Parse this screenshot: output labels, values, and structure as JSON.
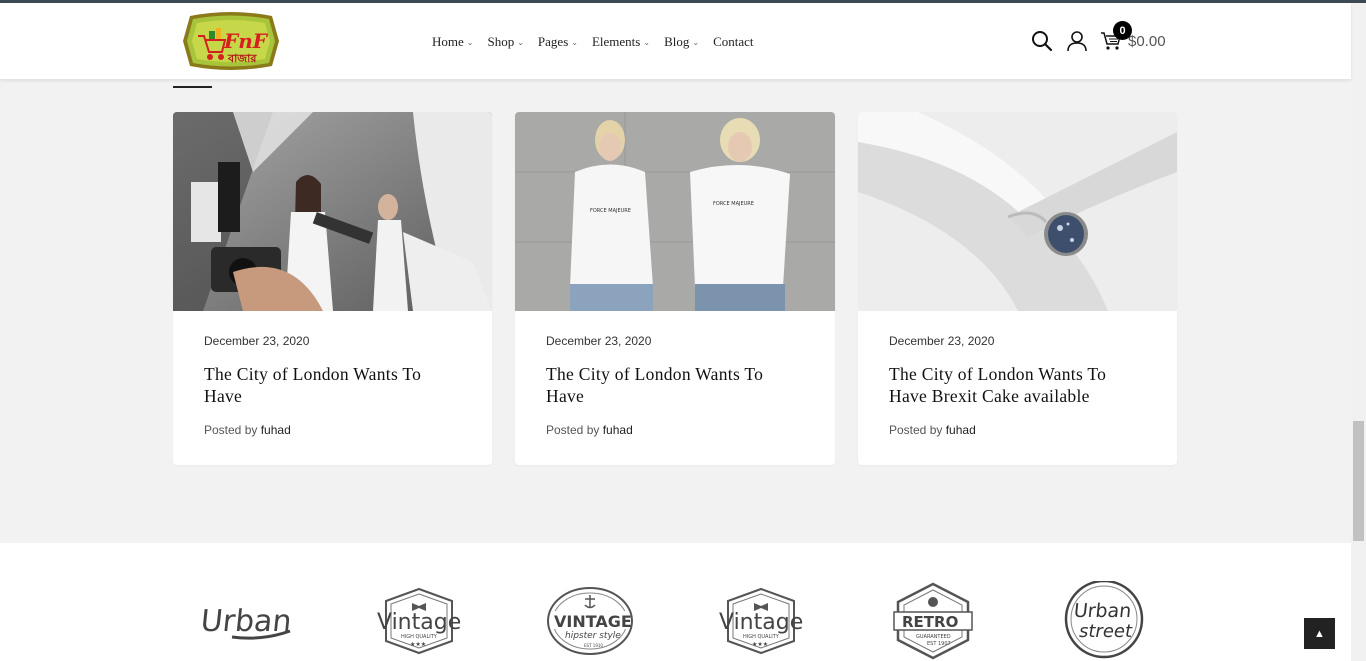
{
  "header": {
    "logo_text": "FnF বাজার",
    "nav": [
      {
        "label": "Home",
        "has_dropdown": true
      },
      {
        "label": "Shop",
        "has_dropdown": true
      },
      {
        "label": "Pages",
        "has_dropdown": true
      },
      {
        "label": "Elements",
        "has_dropdown": true
      },
      {
        "label": "Blog",
        "has_dropdown": true
      },
      {
        "label": "Contact",
        "has_dropdown": false
      }
    ],
    "icons": [
      "search-icon",
      "user-icon",
      "cart-icon"
    ],
    "cart_count": "0",
    "cart_total": "$0.00"
  },
  "posts": [
    {
      "date": "December 23, 2020",
      "title": "The City of London Wants To Have",
      "posted_by_label": "Posted by",
      "author": "fuhad",
      "image": "photoshoot-scene"
    },
    {
      "date": "December 23, 2020",
      "title": "The City of London Wants To Have",
      "posted_by_label": "Posted by",
      "author": "fuhad",
      "image": "couple-white-tshirts"
    },
    {
      "date": "December 23, 2020",
      "title": "The City of London Wants To Have Brexit Cake available",
      "posted_by_label": "Posted by",
      "author": "fuhad",
      "image": "ring-on-ribbon"
    }
  ],
  "brands": [
    {
      "name": "Urban"
    },
    {
      "name": "Vintage",
      "sub": "HIGH QUALITY"
    },
    {
      "name": "VINTAGE",
      "sub": "hipster style"
    },
    {
      "name": "Vintage",
      "sub": "HIGH QUALITY"
    },
    {
      "name": "RETRO",
      "sub": "GUARANTEED"
    },
    {
      "name": "Urban street"
    }
  ],
  "colors": {
    "accent": "#000000",
    "background": "#f2f2f2",
    "topline": "#3d4a54"
  }
}
